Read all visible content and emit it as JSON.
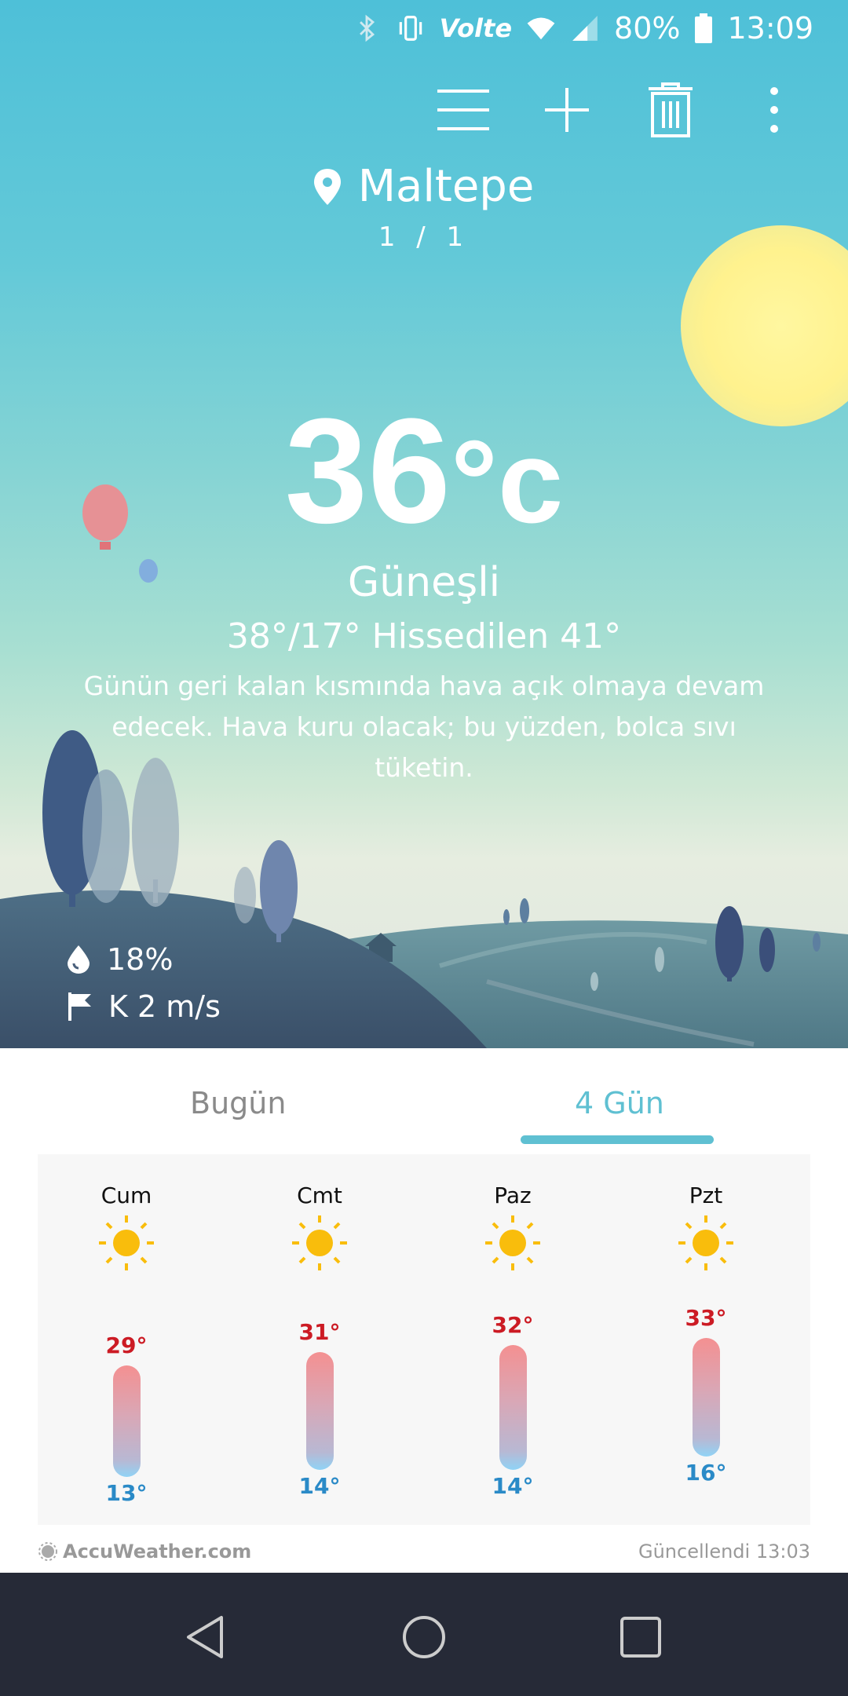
{
  "statusbar": {
    "network": "Volte",
    "battery": "80%",
    "time": "13:09",
    "icons": [
      "bluetooth-icon",
      "vibrate-icon",
      "wifi-icon",
      "signal-icon",
      "battery-icon"
    ]
  },
  "toolbar": {
    "icons": [
      "menu-icon",
      "add-icon",
      "delete-icon",
      "more-vert-icon"
    ]
  },
  "location": {
    "name": "Maltepe",
    "page": "1 / 1"
  },
  "current": {
    "temp": "36",
    "unit": "°c",
    "condition": "Güneşli",
    "hilo": "38°/17° Hissedilen 41°",
    "description": "Günün geri kalan kısmında hava açık olmaya devam edecek. Hava kuru olacak; bu yüzden, bolca sıvı tüketin.",
    "humidity": "18%",
    "wind": "K 2 m/s"
  },
  "tabs": [
    {
      "label": "Bugün",
      "active": false
    },
    {
      "label": "4 Gün",
      "active": true
    }
  ],
  "forecast": [
    {
      "day": "Cum",
      "high": "29°",
      "low": "13°",
      "icon": "sun-icon",
      "high_value": 29,
      "low_value": 13
    },
    {
      "day": "Cmt",
      "high": "31°",
      "low": "14°",
      "icon": "sun-icon",
      "high_value": 31,
      "low_value": 14
    },
    {
      "day": "Paz",
      "high": "32°",
      "low": "14°",
      "icon": "sun-icon",
      "high_value": 32,
      "low_value": 14
    },
    {
      "day": "Pzt",
      "high": "33°",
      "low": "16°",
      "icon": "sun-icon",
      "high_value": 33,
      "low_value": 16
    }
  ],
  "footer": {
    "brand": "AccuWeather.com",
    "updated": "Güncellendi 13:03"
  },
  "navbar": {
    "icons": [
      "back-icon",
      "home-icon",
      "recents-icon"
    ]
  },
  "colors": {
    "accent": "#5fc0d2",
    "high": "#cc1b24",
    "low": "#2a8ac7",
    "navbar": "#262a37"
  }
}
